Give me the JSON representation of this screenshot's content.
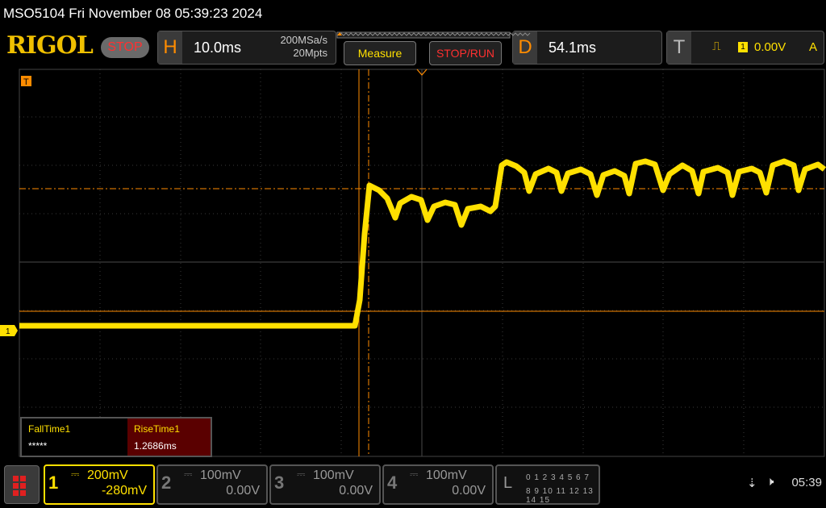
{
  "title_bar": {
    "text": "MSO5104  Fri November 08 05:39:23 2024"
  },
  "header": {
    "logo": "RIGOL",
    "run_state": "STOP",
    "horizontal": {
      "letter": "H",
      "timebase": "10.0ms",
      "sample_rate": "200MSa/s",
      "memory_depth": "20Mpts"
    },
    "measure_button": "Measure",
    "stop_run_button": "STOP/RUN",
    "delay": {
      "letter": "D",
      "value": "54.1ms"
    },
    "trigger": {
      "letter": "T",
      "edge_icon": "rising-edge-icon",
      "channel": "1",
      "level": "0.00V",
      "mode": "A"
    }
  },
  "waveform": {
    "channel_marker": "1",
    "trigger_marker": "T",
    "color": "#ffe000",
    "cursor_color": "#ff8c00",
    "grid_color": "#3a3a3a"
  },
  "measurements": [
    {
      "label": "FallTime1",
      "value": "*****"
    },
    {
      "label": "RiseTime1",
      "value": "1.2686ms"
    }
  ],
  "channels": [
    {
      "num": "1",
      "scale": "200mV",
      "offset": "-280mV",
      "active": true
    },
    {
      "num": "2",
      "scale": "100mV",
      "offset": "0.00V",
      "active": false
    },
    {
      "num": "3",
      "scale": "100mV",
      "offset": "0.00V",
      "active": false
    },
    {
      "num": "4",
      "scale": "100mV",
      "offset": "0.00V",
      "active": false
    }
  ],
  "logic": {
    "letter": "L",
    "row1": "0 1 2 3  4 5 6 7",
    "row2": "8 9 10 11 12 13 14 15"
  },
  "status": {
    "time": "05:39",
    "usb_icon": "usb-icon",
    "speaker_icon": "speaker-muted-icon"
  }
}
